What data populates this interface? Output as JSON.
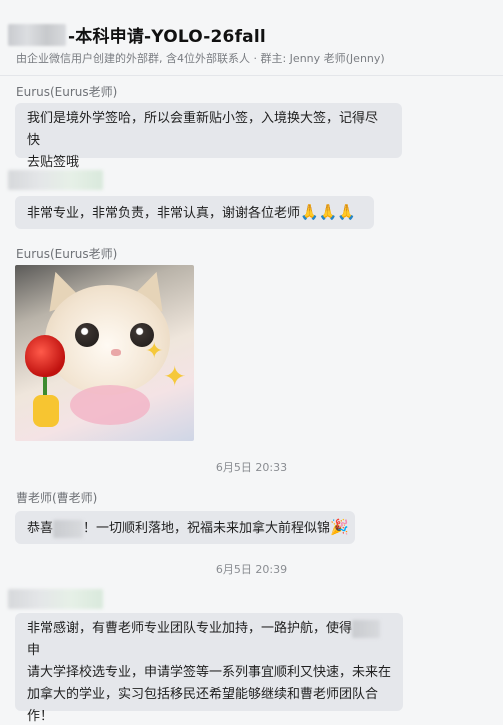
{
  "header": {
    "title": "-本科申请-YOLO-26fall",
    "subtitle": "由企业微信用户创建的外部群, 含4位外部联系人 · 群主: Jenny 老师(Jenny)"
  },
  "messages": [
    {
      "sender": "Eurus(Eurus老师)",
      "line1": "我们是境外学签哈，所以会重新贴小签，入境换大签，记得尽快",
      "line2": "去贴签哦"
    },
    {
      "text": "非常专业，非常负责，非常认真，谢谢各位老师",
      "emoji": "🙏🙏🙏"
    },
    {
      "sender": "Eurus(Eurus老师)"
    },
    {
      "timestamp": "6月5日 20:33"
    },
    {
      "sender": "曹老师(曹老师)",
      "prefix": "恭喜",
      "text": "！一切顺利落地，祝福未来加拿大前程似锦",
      "emoji": "🎉"
    },
    {
      "timestamp": "6月5日 20:39"
    },
    {
      "line1a": "非常感谢，有曹老师专业团队专业加持，一路护航，使得",
      "line1b": "申",
      "line2": "请大学择校选专业，申请学签等一系列事宜顺利又快速，未来在",
      "line3": "加拿大的学业，实习包括移民还希望能够继续和曹老师团队合",
      "line4": "作！"
    }
  ]
}
